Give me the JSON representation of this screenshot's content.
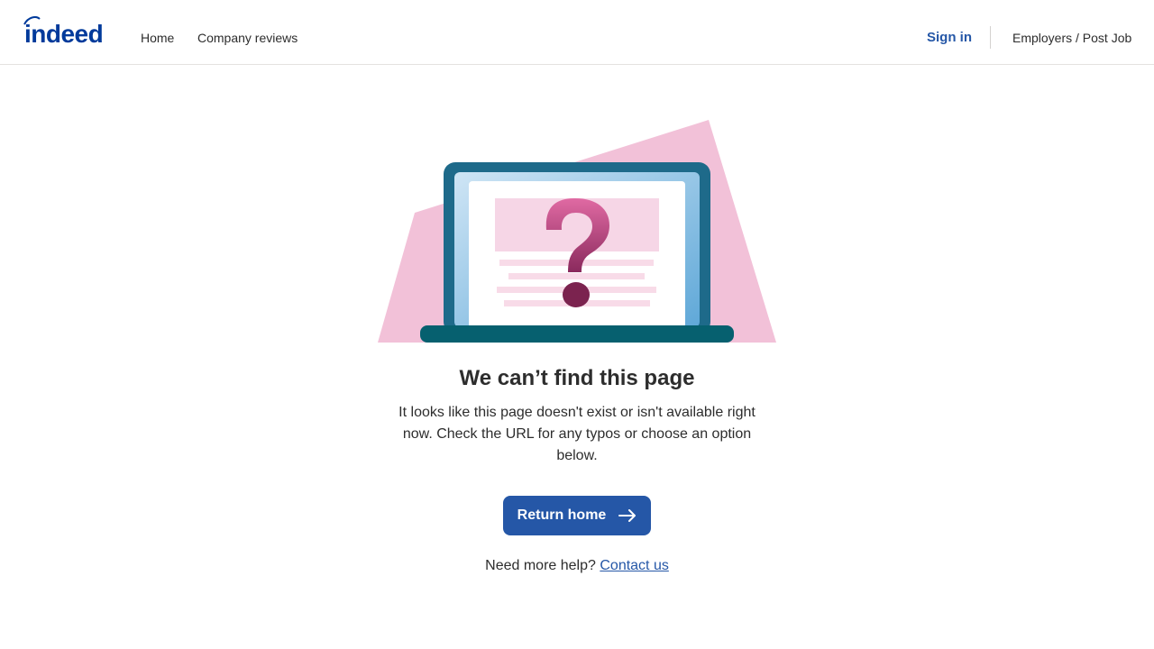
{
  "header": {
    "logo_icon": "indeed-logo",
    "nav": [
      {
        "label": "Home"
      },
      {
        "label": "Company reviews"
      }
    ],
    "sign_in_label": "Sign in",
    "employers_label": "Employers / Post Job"
  },
  "main": {
    "illustration_icon": "laptop-question-mark-illustration",
    "headline": "We can’t find this page",
    "description": "It looks like this page doesn't exist or isn't available right now. Check the URL for any typos or choose an option below.",
    "return_button_label": "Return home",
    "return_button_icon": "arrow-right-icon",
    "help_text": "Need more help?",
    "help_link_label": "Contact us"
  },
  "colors": {
    "brand_blue": "#2557a7",
    "logo_blue": "#003a9b",
    "illustration_pink": "#f2c1d8",
    "laptop_teal": "#1e6a8a"
  }
}
